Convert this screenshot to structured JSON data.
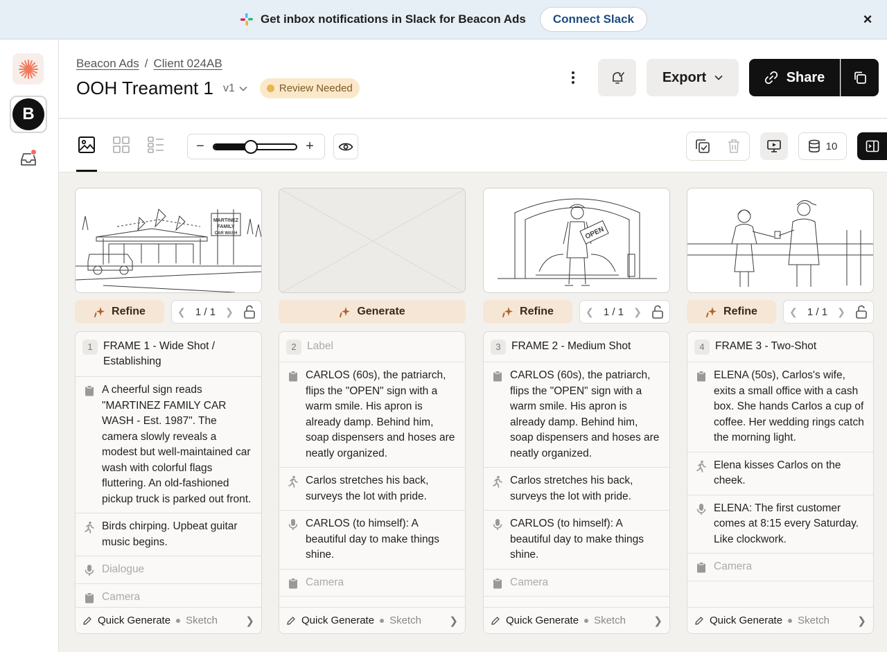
{
  "banner": {
    "message": "Get inbox notifications in Slack for Beacon Ads",
    "cta": "Connect Slack"
  },
  "rail": {
    "workspace_letter": "B"
  },
  "header": {
    "breadcrumb": [
      "Beacon Ads",
      "Client 024AB"
    ],
    "breadcrumb_sep": "/",
    "title": "OOH Treament 1",
    "version": "v1",
    "status": "Review Needed",
    "export_label": "Export",
    "share_label": "Share"
  },
  "toolbar": {
    "zoom_level": 0.45,
    "zoom_minus": "−",
    "zoom_plus": "+",
    "credits": "10"
  },
  "frames": [
    {
      "num": "1",
      "title": "FRAME 1 - Wide Shot / Establishing",
      "action_label": "Refine",
      "pager": "1 / 1",
      "has_pager": true,
      "image": "car-wash-exterior",
      "description": "A cheerful sign reads \"MARTINEZ FAMILY CAR WASH - Est. 1987\". The camera slowly reveals a modest but well-maintained car wash with colorful flags fluttering. An old-fashioned pickup truck is parked out front.",
      "action": "Birds chirping. Upbeat guitar music begins.",
      "dialogue": "",
      "dialogue_placeholder": "Dialogue",
      "camera": "",
      "camera_placeholder": "Camera",
      "footer": "Quick Generate",
      "footer_style": "Sketch"
    },
    {
      "num": "2",
      "title": "",
      "title_placeholder": "Label",
      "action_label": "Generate",
      "has_pager": false,
      "image": "empty",
      "description": "CARLOS (60s), the patriarch, flips the \"OPEN\" sign with a warm smile. His apron is already damp. Behind him, soap dispensers and hoses are neatly organized.",
      "action": "Carlos stretches his back, surveys the lot with pride.",
      "dialogue": "CARLOS (to himself): A beautiful day to make things shine.",
      "camera": "",
      "camera_placeholder": "Camera",
      "footer": "Quick Generate",
      "footer_style": "Sketch"
    },
    {
      "num": "3",
      "title": "FRAME 2 - Medium Shot",
      "action_label": "Refine",
      "pager": "1 / 1",
      "has_pager": true,
      "image": "carlos-open-sign",
      "sign_text": "OPEN",
      "description": "CARLOS (60s), the patriarch, flips the \"OPEN\" sign with a warm smile. His apron is already damp. Behind him, soap dispensers and hoses are neatly organized.",
      "action": "Carlos stretches his back, surveys the lot with pride.",
      "dialogue": "CARLOS (to himself): A beautiful day to make things shine.",
      "camera": "",
      "camera_placeholder": "Camera",
      "footer": "Quick Generate",
      "footer_style": "Sketch"
    },
    {
      "num": "4",
      "title": "FRAME 3 - Two-Shot",
      "action_label": "Refine",
      "pager": "1 / 1",
      "has_pager": true,
      "image": "elena-carlos-coffee",
      "description": "ELENA (50s), Carlos's wife, exits a small office with a cash box. She hands Carlos a cup of coffee. Her wedding rings catch the morning light.",
      "action": "Elena kisses Carlos on the cheek.",
      "dialogue": "ELENA: The first customer comes at 8:15 every Saturday. Like clockwork.",
      "camera": "",
      "camera_placeholder": "Camera",
      "footer": "Quick Generate",
      "footer_style": "Sketch"
    }
  ],
  "sketch_text": {
    "sign_1": "MARTINEZ",
    "sign_2": "FAMILY",
    "sign_3": "CAR WASH"
  }
}
